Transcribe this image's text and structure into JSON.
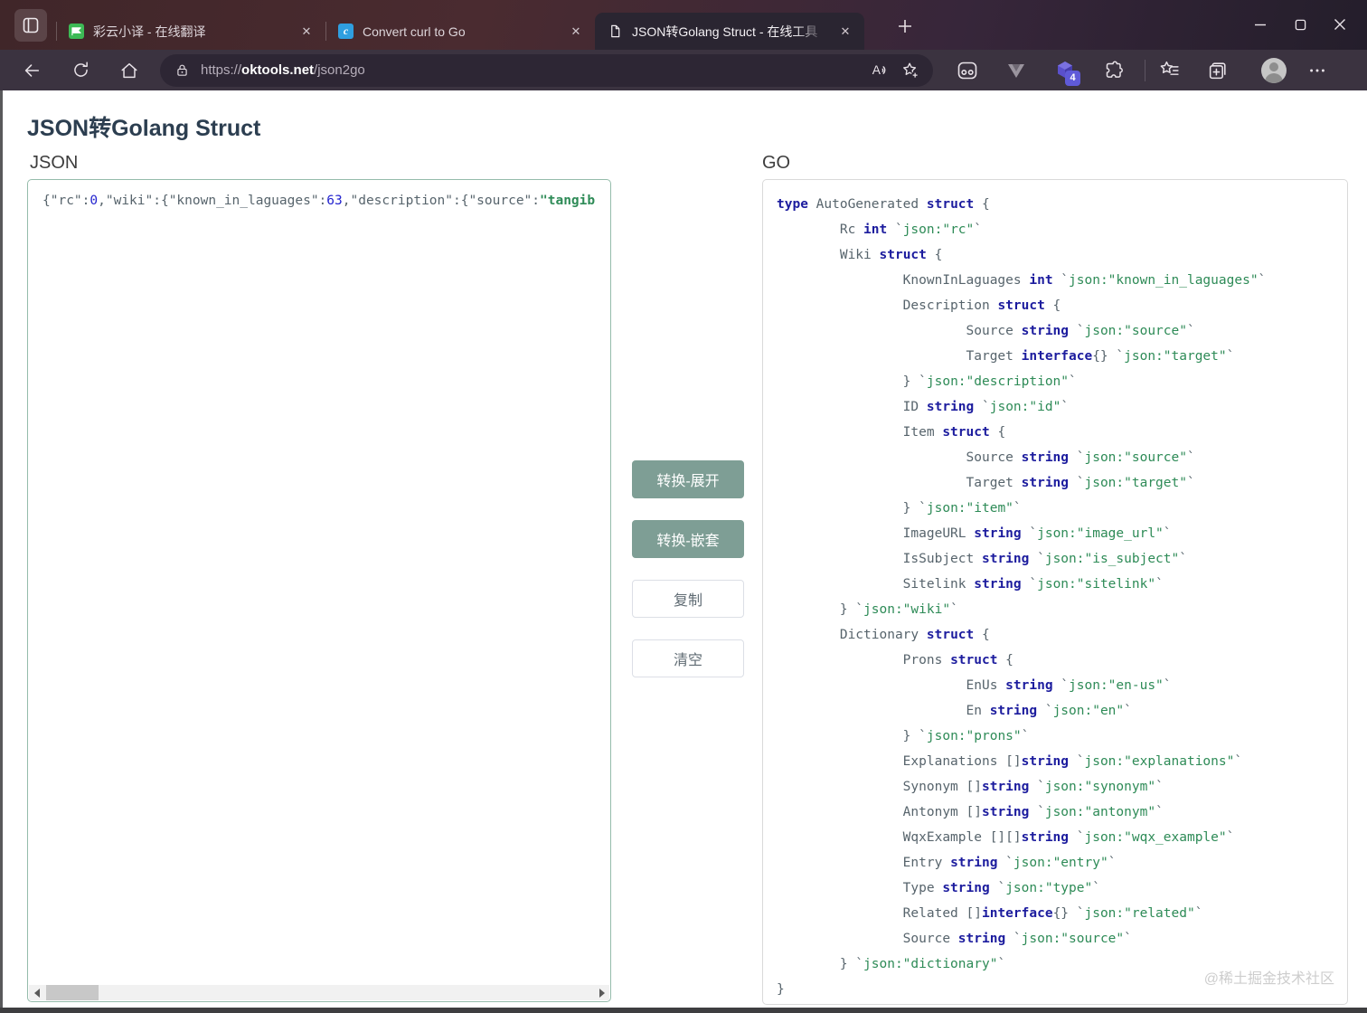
{
  "browser": {
    "tabs": [
      {
        "title": "彩云小译 - 在线翻译",
        "icon": "caiyun",
        "active": false
      },
      {
        "title": "Convert curl to Go",
        "icon": "curl",
        "active": false
      },
      {
        "title": "JSON转Golang Struct - 在线工具",
        "icon": "document",
        "active": true
      }
    ],
    "address": {
      "scheme": "https://",
      "host": "oktools.net",
      "path": "/json2go"
    },
    "extension_badge": "4"
  },
  "page": {
    "title": "JSON转Golang Struct",
    "json_label": "JSON",
    "go_label": "GO",
    "buttons": {
      "convert_expand": "转换-展开",
      "convert_nested": "转换-嵌套",
      "copy": "复制",
      "clear": "清空"
    },
    "watermark": "@稀土掘金技术社区",
    "colors": {
      "primary_button": "#7e9e95",
      "textarea_border": "#95bcab",
      "keyword": "#1c1c9e",
      "identifier": "#57646c",
      "tag_green": "#2e8b57",
      "number_blue": "#2424cf"
    },
    "json_input": {
      "tokens": [
        [
          "i",
          "{\"rc\":"
        ],
        [
          "n",
          "0"
        ],
        [
          "i",
          ",\"wiki\":{\"known_in_laguages\":"
        ],
        [
          "n",
          "63"
        ],
        [
          "i",
          ",\"description\":{\"source\":"
        ],
        [
          "s",
          "\"tangib"
        ]
      ]
    },
    "go_code": {
      "lines": [
        [
          [
            "k",
            "type"
          ],
          [
            "i",
            " AutoGenerated "
          ],
          [
            "k",
            "struct"
          ],
          [
            "i",
            " {"
          ]
        ],
        [
          [
            "i",
            "        Rc "
          ],
          [
            "k",
            "int"
          ],
          [
            "i",
            " `"
          ],
          [
            "t",
            "json:\"rc\""
          ],
          [
            "i",
            "`"
          ]
        ],
        [
          [
            "i",
            "        Wiki "
          ],
          [
            "k",
            "struct"
          ],
          [
            "i",
            " {"
          ]
        ],
        [
          [
            "i",
            "                KnownInLaguages "
          ],
          [
            "k",
            "int"
          ],
          [
            "i",
            " `"
          ],
          [
            "t",
            "json:\"known_in_laguages\""
          ],
          [
            "i",
            "`"
          ]
        ],
        [
          [
            "i",
            "                Description "
          ],
          [
            "k",
            "struct"
          ],
          [
            "i",
            " {"
          ]
        ],
        [
          [
            "i",
            "                        Source "
          ],
          [
            "k",
            "string"
          ],
          [
            "i",
            " `"
          ],
          [
            "t",
            "json:\"source\""
          ],
          [
            "i",
            "`"
          ]
        ],
        [
          [
            "i",
            "                        Target "
          ],
          [
            "k",
            "interface"
          ],
          [
            "i",
            "{} `"
          ],
          [
            "t",
            "json:\"target\""
          ],
          [
            "i",
            "`"
          ]
        ],
        [
          [
            "i",
            "                } `"
          ],
          [
            "t",
            "json:\"description\""
          ],
          [
            "i",
            "`"
          ]
        ],
        [
          [
            "i",
            "                ID "
          ],
          [
            "k",
            "string"
          ],
          [
            "i",
            " `"
          ],
          [
            "t",
            "json:\"id\""
          ],
          [
            "i",
            "`"
          ]
        ],
        [
          [
            "i",
            "                Item "
          ],
          [
            "k",
            "struct"
          ],
          [
            "i",
            " {"
          ]
        ],
        [
          [
            "i",
            "                        Source "
          ],
          [
            "k",
            "string"
          ],
          [
            "i",
            " `"
          ],
          [
            "t",
            "json:\"source\""
          ],
          [
            "i",
            "`"
          ]
        ],
        [
          [
            "i",
            "                        Target "
          ],
          [
            "k",
            "string"
          ],
          [
            "i",
            " `"
          ],
          [
            "t",
            "json:\"target\""
          ],
          [
            "i",
            "`"
          ]
        ],
        [
          [
            "i",
            "                } `"
          ],
          [
            "t",
            "json:\"item\""
          ],
          [
            "i",
            "`"
          ]
        ],
        [
          [
            "i",
            "                ImageURL "
          ],
          [
            "k",
            "string"
          ],
          [
            "i",
            " `"
          ],
          [
            "t",
            "json:\"image_url\""
          ],
          [
            "i",
            "`"
          ]
        ],
        [
          [
            "i",
            "                IsSubject "
          ],
          [
            "k",
            "string"
          ],
          [
            "i",
            " `"
          ],
          [
            "t",
            "json:\"is_subject\""
          ],
          [
            "i",
            "`"
          ]
        ],
        [
          [
            "i",
            "                Sitelink "
          ],
          [
            "k",
            "string"
          ],
          [
            "i",
            " `"
          ],
          [
            "t",
            "json:\"sitelink\""
          ],
          [
            "i",
            "`"
          ]
        ],
        [
          [
            "i",
            "        } `"
          ],
          [
            "t",
            "json:\"wiki\""
          ],
          [
            "i",
            "`"
          ]
        ],
        [
          [
            "i",
            "        Dictionary "
          ],
          [
            "k",
            "struct"
          ],
          [
            "i",
            " {"
          ]
        ],
        [
          [
            "i",
            "                Prons "
          ],
          [
            "k",
            "struct"
          ],
          [
            "i",
            " {"
          ]
        ],
        [
          [
            "i",
            "                        EnUs "
          ],
          [
            "k",
            "string"
          ],
          [
            "i",
            " `"
          ],
          [
            "t",
            "json:\"en-us\""
          ],
          [
            "i",
            "`"
          ]
        ],
        [
          [
            "i",
            "                        En "
          ],
          [
            "k",
            "string"
          ],
          [
            "i",
            " `"
          ],
          [
            "t",
            "json:\"en\""
          ],
          [
            "i",
            "`"
          ]
        ],
        [
          [
            "i",
            "                } `"
          ],
          [
            "t",
            "json:\"prons\""
          ],
          [
            "i",
            "`"
          ]
        ],
        [
          [
            "i",
            "                Explanations []"
          ],
          [
            "k",
            "string"
          ],
          [
            "i",
            " `"
          ],
          [
            "t",
            "json:\"explanations\""
          ],
          [
            "i",
            "`"
          ]
        ],
        [
          [
            "i",
            "                Synonym []"
          ],
          [
            "k",
            "string"
          ],
          [
            "i",
            " `"
          ],
          [
            "t",
            "json:\"synonym\""
          ],
          [
            "i",
            "`"
          ]
        ],
        [
          [
            "i",
            "                Antonym []"
          ],
          [
            "k",
            "string"
          ],
          [
            "i",
            " `"
          ],
          [
            "t",
            "json:\"antonym\""
          ],
          [
            "i",
            "`"
          ]
        ],
        [
          [
            "i",
            "                WqxExample [][]"
          ],
          [
            "k",
            "string"
          ],
          [
            "i",
            " `"
          ],
          [
            "t",
            "json:\"wqx_example\""
          ],
          [
            "i",
            "`"
          ]
        ],
        [
          [
            "i",
            "                Entry "
          ],
          [
            "k",
            "string"
          ],
          [
            "i",
            " `"
          ],
          [
            "t",
            "json:\"entry\""
          ],
          [
            "i",
            "`"
          ]
        ],
        [
          [
            "i",
            "                Type "
          ],
          [
            "k",
            "string"
          ],
          [
            "i",
            " `"
          ],
          [
            "t",
            "json:\"type\""
          ],
          [
            "i",
            "`"
          ]
        ],
        [
          [
            "i",
            "                Related []"
          ],
          [
            "k",
            "interface"
          ],
          [
            "i",
            "{} `"
          ],
          [
            "t",
            "json:\"related\""
          ],
          [
            "i",
            "`"
          ]
        ],
        [
          [
            "i",
            "                Source "
          ],
          [
            "k",
            "string"
          ],
          [
            "i",
            " `"
          ],
          [
            "t",
            "json:\"source\""
          ],
          [
            "i",
            "`"
          ]
        ],
        [
          [
            "i",
            "        } `"
          ],
          [
            "t",
            "json:\"dictionary\""
          ],
          [
            "i",
            "`"
          ]
        ],
        [
          [
            "i",
            "}"
          ]
        ]
      ]
    }
  }
}
